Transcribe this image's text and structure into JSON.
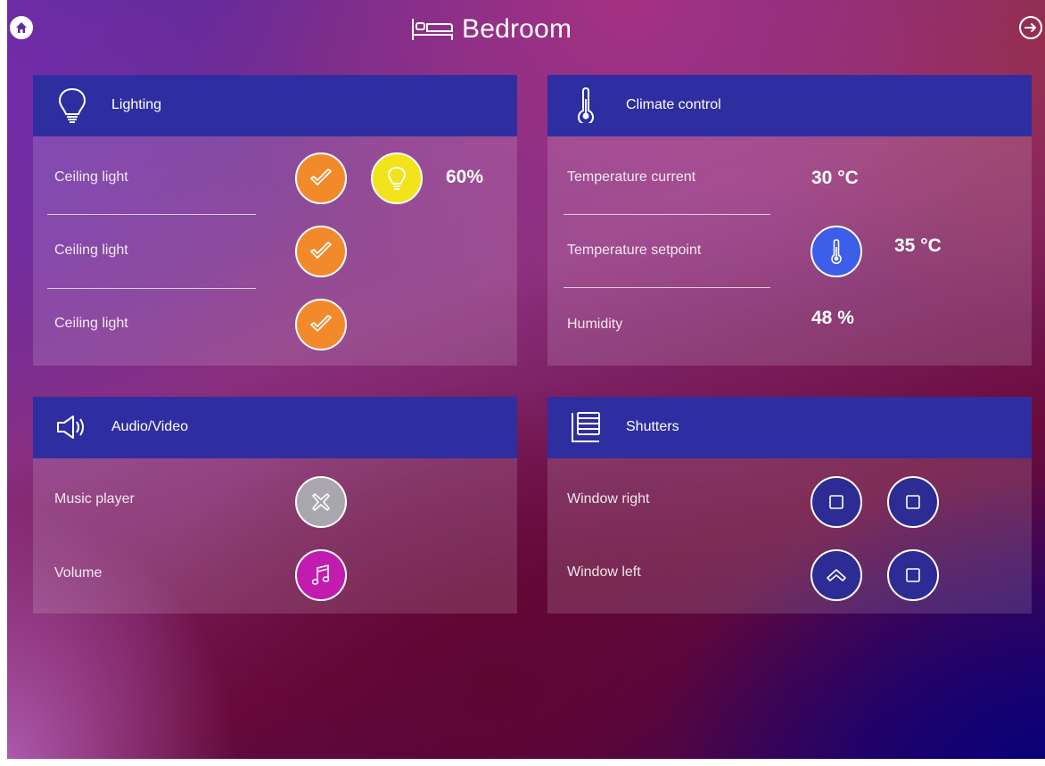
{
  "header": {
    "title": "Bedroom"
  },
  "lighting": {
    "title": "Lighting",
    "rows": [
      {
        "label": "Ceiling light",
        "dimmer_value": "60%"
      },
      {
        "label": "Ceiling light"
      },
      {
        "label": "Ceiling light"
      }
    ]
  },
  "climate": {
    "title": "Climate control",
    "rows": [
      {
        "label": "Temperature current",
        "value": "30 °C"
      },
      {
        "label": "Temperature setpoint",
        "value": "35 °C"
      },
      {
        "label": "Humidity",
        "value": "48 %"
      }
    ]
  },
  "audio": {
    "title": "Audio/Video",
    "rows": [
      {
        "label": "Music player"
      },
      {
        "label": "Volume"
      }
    ]
  },
  "shutters": {
    "title": "Shutters",
    "rows": [
      {
        "label": "Window right"
      },
      {
        "label": "Window left"
      }
    ]
  },
  "colors": {
    "header_blue": "#2e2ea0",
    "toggle_orange": "#f28a2c",
    "dimmer_yellow": "#f3e31c",
    "inactive_grey": "#a9a6ad",
    "music_magenta": "#c21bb0",
    "thermo_blue": "#3c5ee8",
    "shutter_navy": "#2d2c94"
  },
  "icons": {
    "home": "home-icon",
    "exit": "exit-arrow-icon",
    "room": "bed-icon",
    "lighting": "bulb-icon",
    "climate": "thermometer-icon",
    "audio": "speaker-icon",
    "shutters": "shutter-icon",
    "toggle_on": "check-icon",
    "dimmer": "bulb-icon",
    "music_off": "cross-icon",
    "volume": "music-note-icon",
    "stop": "stop-square-icon",
    "up": "chevron-up-icon"
  }
}
